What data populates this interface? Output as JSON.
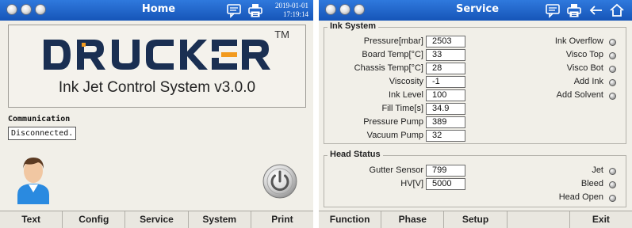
{
  "home": {
    "title": "Home",
    "date": "2019-01-01",
    "time": "17:19:14",
    "brand_logo_text": "DRUCKER",
    "trademark": "TM",
    "subtitle": "Ink Jet Control System  v3.0.0",
    "communication_label": "Communication",
    "communication_status": "Disconnected.",
    "nav": [
      "Text",
      "Config",
      "Service",
      "System",
      "Print"
    ]
  },
  "service": {
    "title": "Service",
    "ink_system": {
      "title": "Ink System",
      "params": [
        {
          "label": "Pressure[mbar]",
          "value": "2503"
        },
        {
          "label": "Board Temp[°C]",
          "value": "33"
        },
        {
          "label": "Chassis Temp[°C]",
          "value": "28"
        },
        {
          "label": "Viscosity",
          "value": "-1"
        },
        {
          "label": "Ink Level",
          "value": "100"
        },
        {
          "label": "Fill Time[s]",
          "value": "34.9"
        },
        {
          "label": "Pressure Pump",
          "value": "389"
        },
        {
          "label": "Vacuum Pump",
          "value": "32"
        }
      ],
      "indicators": [
        "Ink Overflow",
        "Visco Top",
        "Visco Bot",
        "Add Ink",
        "Add Solvent"
      ]
    },
    "head_status": {
      "title": "Head Status",
      "params": [
        {
          "label": "Gutter Sensor",
          "value": "799"
        },
        {
          "label": "HV[V]",
          "value": "5000"
        }
      ],
      "indicators": [
        "Jet",
        "Bleed",
        "Head Open"
      ]
    },
    "nav": [
      "Function",
      "Phase",
      "Setup",
      "",
      "Exit"
    ]
  },
  "colors": {
    "titlebar": "#1f63c8",
    "background": "#f1efe8",
    "brand_dark": "#1a2f52",
    "brand_accent": "#f29a1e",
    "avatar_shirt": "#2a8ae0"
  },
  "icons": [
    "window-dots",
    "message-icon",
    "printer-icon",
    "back-arrow-icon",
    "home-icon",
    "power-icon",
    "user-avatar-icon"
  ]
}
